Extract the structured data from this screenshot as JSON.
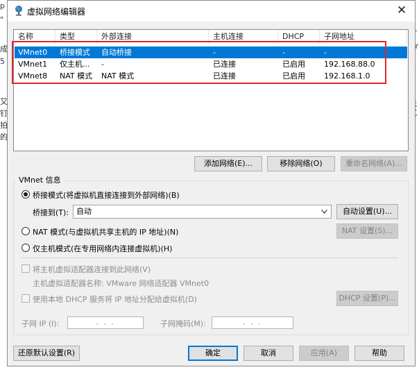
{
  "window": {
    "title": "虚拟网络编辑器",
    "close_glyph": "✕"
  },
  "background": {
    "left_lines": [
      "p",
      "\"",
      "成",
      "5",
      "又",
      "钉",
      "拍",
      "的"
    ],
    "right_lines": [
      "Pr",
      "Dr",
      "了",
      "V",
      "P",
      "无",
      "式"
    ]
  },
  "network_table": {
    "columns": [
      "名称",
      "类型",
      "外部连接",
      "主机连接",
      "DHCP",
      "子网地址"
    ],
    "rows": [
      {
        "name": "VMnet0",
        "type": "桥接模式",
        "external": "自动桥接",
        "host": "-",
        "dhcp": "-",
        "subnet": "-",
        "selected": true
      },
      {
        "name": "VMnet1",
        "type": "仅主机...",
        "external": "-",
        "host": "已连接",
        "dhcp": "已启用",
        "subnet": "192.168.88.0",
        "selected": false
      },
      {
        "name": "VMnet8",
        "type": "NAT 模式",
        "external": "NAT 模式",
        "host": "已连接",
        "dhcp": "已启用",
        "subnet": "192.168.1.0",
        "selected": false
      }
    ]
  },
  "list_buttons": {
    "add": "添加网络(E)...",
    "remove": "移除网络(O)",
    "rename": "重命名网络(A)..."
  },
  "vmnet_info": {
    "group_title": "VMnet 信息",
    "bridged_label": "桥接模式(将虚拟机直接连接到外部网络)(B)",
    "bridge_to_label": "桥接到(T):",
    "bridge_to_value": "自动",
    "auto_settings": "自动设置(U)...",
    "nat_label": "NAT 模式(与虚拟机共享主机的 IP 地址)(N)",
    "nat_settings": "NAT 设置(S)...",
    "hostonly_label": "仅主机模式(在专用网络内连接虚拟机)(H)",
    "connect_adapter_label": "将主机虚拟适配器连接到此网络(V)",
    "adapter_name_label": "主机虚拟适配器名称: VMware 网络适配器 VMnet0",
    "dhcp_label": "使用本地 DHCP 服务将 IP 地址分配给虚拟机(D)",
    "dhcp_settings": "DHCP 设置(P)...",
    "subnet_ip_label": "子网 IP (I):",
    "subnet_ip_value": ". . .",
    "subnet_mask_label": "子网掩码(M):",
    "subnet_mask_value": ". . ."
  },
  "footer": {
    "restore": "还原默认设置(R)",
    "ok": "确定",
    "cancel": "取消",
    "apply": "应用(A)",
    "help": "帮助"
  },
  "colors": {
    "selection": "#0078d7",
    "highlight_box": "#e0262a"
  }
}
